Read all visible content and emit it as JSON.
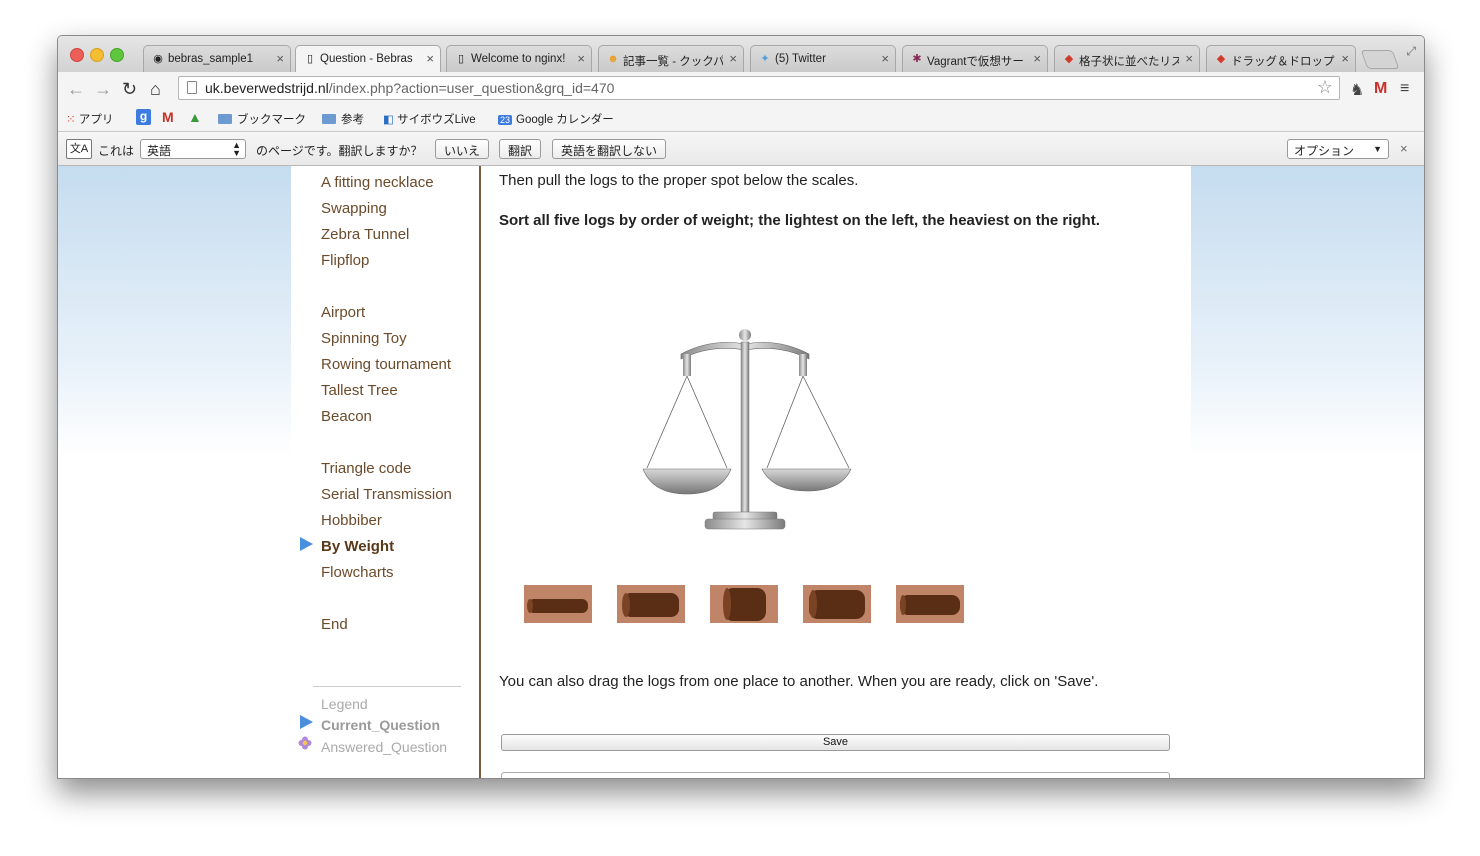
{
  "browser": {
    "tabs": [
      {
        "title": "bebras_sample1",
        "favicon": "github-icon"
      },
      {
        "title": "Question - Bebras",
        "favicon": "page-icon"
      },
      {
        "title": "Welcome to nginx!",
        "favicon": "page-icon"
      },
      {
        "title": "記事一覧 - クックパ",
        "favicon": "cookpad-icon"
      },
      {
        "title": "(5) Twitter",
        "favicon": "twitter-icon"
      },
      {
        "title": "Vagrantで仮想サー",
        "favicon": "asterisk-icon"
      },
      {
        "title": "格子状に並べたリス",
        "favicon": "diamond-icon"
      },
      {
        "title": "ドラッグ＆ドロップ",
        "favicon": "diamond-icon"
      }
    ],
    "url_host": "uk.beverwedstrijd.nl",
    "url_path": "/index.php?action=user_question&grq_id=470"
  },
  "bookmarks": {
    "apps": "アプリ",
    "bookmarks_folder": "ブックマーク",
    "reference_folder": "参考",
    "cybozu": "サイボウズLive",
    "calendar_icon": "23",
    "calendar": "Google カレンダー"
  },
  "translate_bar": {
    "icon_label": "文A",
    "prefix": "これは",
    "language": "英語",
    "suffix": "のページです。翻訳しますか？",
    "no_button": "いいえ",
    "translate_button": "翻訳",
    "never_button": "英語を翻訳しない",
    "options": "オプション",
    "close": "×"
  },
  "sidebar": {
    "group1": [
      "A fitting necklace",
      "Swapping",
      "Zebra Tunnel",
      "Flipflop"
    ],
    "group2": [
      "Airport",
      "Spinning Toy",
      "Rowing tournament",
      "Tallest Tree",
      "Beacon"
    ],
    "group3_before": [
      "Triangle code",
      "Serial Transmission",
      "Hobbiber"
    ],
    "current": "By Weight",
    "group3_after": [
      "Flowcharts"
    ],
    "end": "End",
    "legend": {
      "title": "Legend",
      "current": "Current_Question",
      "answered": "Answered_Question"
    }
  },
  "main": {
    "instruction1": "Then pull the logs to the proper spot below the scales.",
    "instruction2": "Sort all five logs by order of weight; the lightest on the left, the heaviest on the right.",
    "instruction3": "You can also drag the logs from one place to another. When you are ready, click on 'Save'.",
    "save_label": "Save",
    "log_count": 5
  },
  "colors": {
    "sidebar_link": "#6b4b2b",
    "current_arrow": "#4a8fdc",
    "log_tile": "#c08468",
    "divider": "#7a5a3a"
  }
}
